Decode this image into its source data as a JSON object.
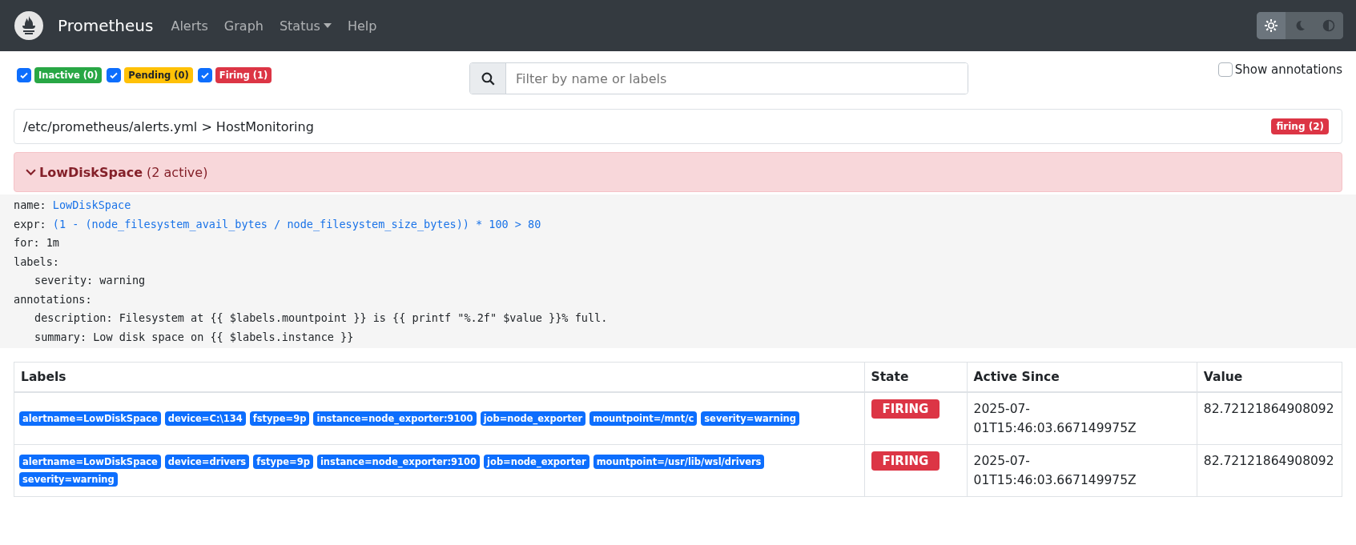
{
  "navbar": {
    "brand": "Prometheus",
    "links": [
      {
        "label": "Alerts",
        "dropdown": false
      },
      {
        "label": "Graph",
        "dropdown": false
      },
      {
        "label": "Status",
        "dropdown": true
      },
      {
        "label": "Help",
        "dropdown": false
      }
    ],
    "theme_buttons": [
      {
        "kind": "light",
        "selected": true
      },
      {
        "kind": "dark",
        "selected": false
      },
      {
        "kind": "auto",
        "selected": false
      }
    ]
  },
  "filters": [
    {
      "label": "Inactive (0)",
      "kind": "inactive",
      "checked": true
    },
    {
      "label": "Pending (0)",
      "kind": "pending",
      "checked": true
    },
    {
      "label": "Firing (1)",
      "kind": "firing",
      "checked": true
    }
  ],
  "search": {
    "placeholder": "Filter by name or labels"
  },
  "show_annotations": {
    "label": "Show annotations",
    "checked": false
  },
  "group": {
    "path": "/etc/prometheus/alerts.yml > HostMonitoring",
    "badge": "firing (2)"
  },
  "rule": {
    "name": "LowDiskSpace",
    "count": "(2 active)",
    "expanded": true,
    "definition": [
      {
        "key": "name:",
        "value": "LowDiskSpace",
        "indent": false,
        "highlight": true
      },
      {
        "key": "expr:",
        "value": "(1 - (node_filesystem_avail_bytes / node_filesystem_size_bytes)) * 100 > 80",
        "indent": false,
        "highlight": true
      },
      {
        "key": "for:",
        "value": "1m",
        "indent": false,
        "highlight": false
      },
      {
        "key": "labels:",
        "indent": false
      },
      {
        "key": "severity:",
        "value": "warning",
        "indent": true,
        "highlight": false
      },
      {
        "key": "annotations:",
        "indent": false
      },
      {
        "key": "description:",
        "value": "Filesystem at {{ $labels.mountpoint }} is {{ printf \"%.2f\" $value }}% full.",
        "indent": true,
        "highlight": false
      },
      {
        "key": "summary:",
        "value": "Low disk space on {{ $labels.instance }}",
        "indent": true,
        "highlight": false
      }
    ]
  },
  "table": {
    "columns": [
      "Labels",
      "State",
      "Active Since",
      "Value"
    ],
    "rows": [
      {
        "labels": [
          "alertname=LowDiskSpace",
          "device=C:\\134",
          "fstype=9p",
          "instance=node_exporter:9100",
          "job=node_exporter",
          "mountpoint=/mnt/c",
          "severity=warning"
        ],
        "state": "FIRING",
        "active_since": "2025-07-01T15:46:03.667149975Z",
        "value": "82.72121864908092"
      },
      {
        "labels": [
          "alertname=LowDiskSpace",
          "device=drivers",
          "fstype=9p",
          "instance=node_exporter:9100",
          "job=node_exporter",
          "mountpoint=/usr/lib/wsl/drivers",
          "severity=warning"
        ],
        "state": "FIRING",
        "active_since": "2025-07-01T15:46:03.667149975Z",
        "value": "82.72121864908092"
      }
    ]
  }
}
